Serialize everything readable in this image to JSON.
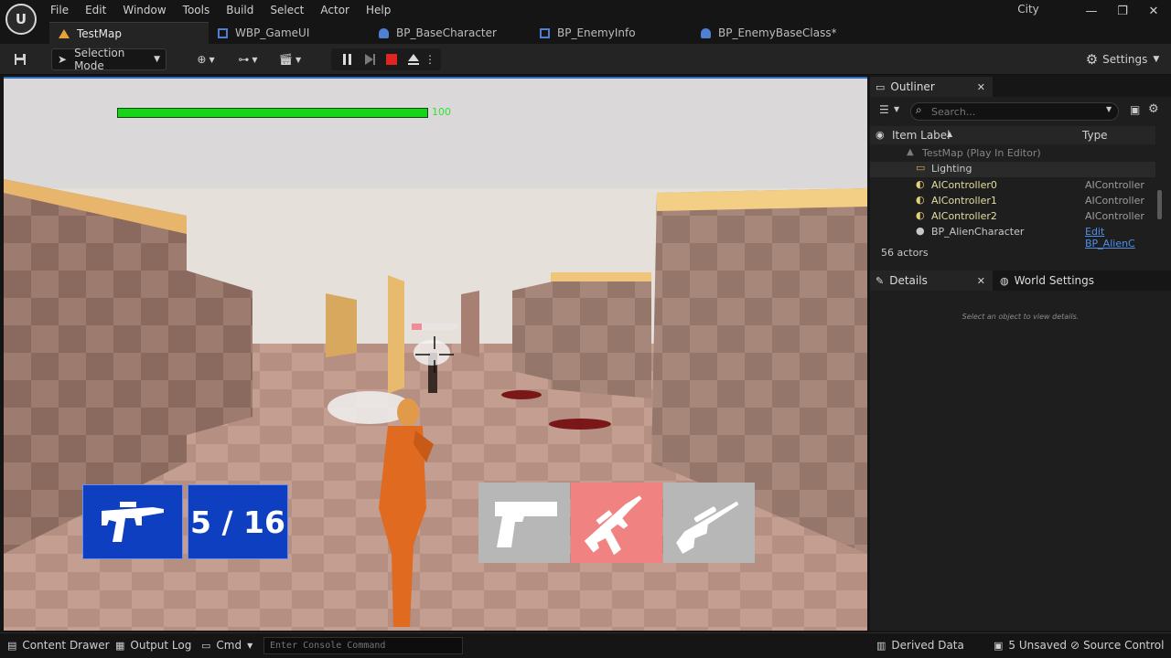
{
  "menu": [
    "File",
    "Edit",
    "Window",
    "Tools",
    "Build",
    "Select",
    "Actor",
    "Help"
  ],
  "project_name": "City",
  "tabs": [
    {
      "label": "TestMap",
      "active": true
    },
    {
      "label": "WBP_GameUI",
      "active": false
    },
    {
      "label": "BP_BaseCharacter",
      "active": false
    },
    {
      "label": "BP_EnemyInfo",
      "active": false
    },
    {
      "label": "BP_EnemyBaseClass*",
      "active": false
    }
  ],
  "toolbar": {
    "selection_mode": "Selection Mode",
    "settings": "Settings"
  },
  "hud": {
    "health_value": "100",
    "health_fraction": 1.0,
    "enemy_health_fraction": 0.22,
    "ammo": "5 / 16",
    "weapons": [
      {
        "name": "pistol-icon",
        "selected": false
      },
      {
        "name": "rifle-icon",
        "selected": true
      },
      {
        "name": "sniper-icon",
        "selected": false
      }
    ]
  },
  "outliner": {
    "tab_label": "Outliner",
    "search_placeholder": "Search...",
    "col_label": "Item Label",
    "col_type": "Type",
    "rows": [
      {
        "label": "TestMap (Play In Editor)",
        "type": ""
      },
      {
        "label": "Lighting",
        "type": ""
      },
      {
        "label": "AIController0",
        "type": "AIController"
      },
      {
        "label": "AIController1",
        "type": "AIController"
      },
      {
        "label": "AIController2",
        "type": "AIController"
      },
      {
        "label": "BP_AlienCharacter",
        "type": "Edit BP_AlienC"
      }
    ],
    "actor_count": "56 actors"
  },
  "details": {
    "tab_label": "Details",
    "world_settings_label": "World Settings",
    "hint": "Select an object to view details."
  },
  "statusbar": {
    "content_drawer": "Content Drawer",
    "output_log": "Output Log",
    "cmd": "Cmd",
    "console_placeholder": "Enter Console Command",
    "derived_data": "Derived Data",
    "unsaved": "5 Unsaved",
    "source_control": "Source Control"
  },
  "colors": {
    "accent": "#2f6fc4",
    "health": "#18d418",
    "hud_blue": "#0d3fc0",
    "weapon_selected": "#f08282",
    "weapon_idle": "#b7b7b7"
  }
}
